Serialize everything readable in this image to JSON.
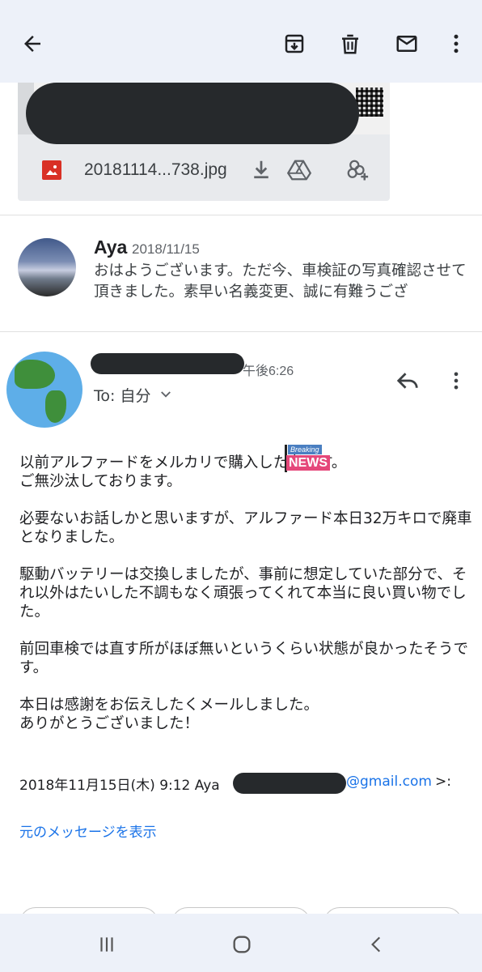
{
  "toolbar": {
    "back_icon": "arrow-back-icon",
    "archive_icon": "archive-icon",
    "delete_icon": "trash-icon",
    "unread_icon": "mail-icon",
    "more_icon": "more-vert-icon"
  },
  "attachment": {
    "file_name": "20181114...738.jpg",
    "image_icon": "image-file-icon",
    "download_icon": "download-icon",
    "drive_icon": "drive-icon",
    "photos_icon": "add-to-photos-icon"
  },
  "collapsed_message": {
    "sender": "Aya",
    "date": "2018/11/15",
    "snippet": "おはようございます。ただ今、車検証の写真確認させて頂きました。素早い名義変更、誠に有難うござ"
  },
  "expanded_message": {
    "time": "午後6:26",
    "to_label": "To: 自分",
    "reply_icon": "reply-icon",
    "more_icon": "more-vert-icon",
    "body": [
      "以前アルファードをメルカリで購入した者です。\nご無沙汰しております。",
      "必要ないお話しかと思いますが、アルファード本日32万キロで廃車となりました。",
      "駆動バッテリーは交換しましたが、事前に想定していた部分で、それ以外はたいした不調もなく頑張ってくれて本当に良い買い物でした。",
      "前回車検では直す所がほぼ無いというくらい状態が良かったそうです。",
      "本日は感謝をお伝えしたくメールしました。\nありがとうございました！"
    ],
    "quote_prefix": "2018年11月15日(木) 9:12 Aya",
    "quote_email": "@gmail.com",
    "quote_suffix": ">:",
    "show_original": "元のメッセージを表示"
  },
  "overlay_badge": {
    "top": "Breaking",
    "main": "NEWS"
  },
  "colors": {
    "appbar_bg": "#edf1f9",
    "link": "#1a73e8",
    "redaction": "#26292c",
    "badge_blue": "#4a7fc1",
    "badge_pink": "#e5477a"
  }
}
